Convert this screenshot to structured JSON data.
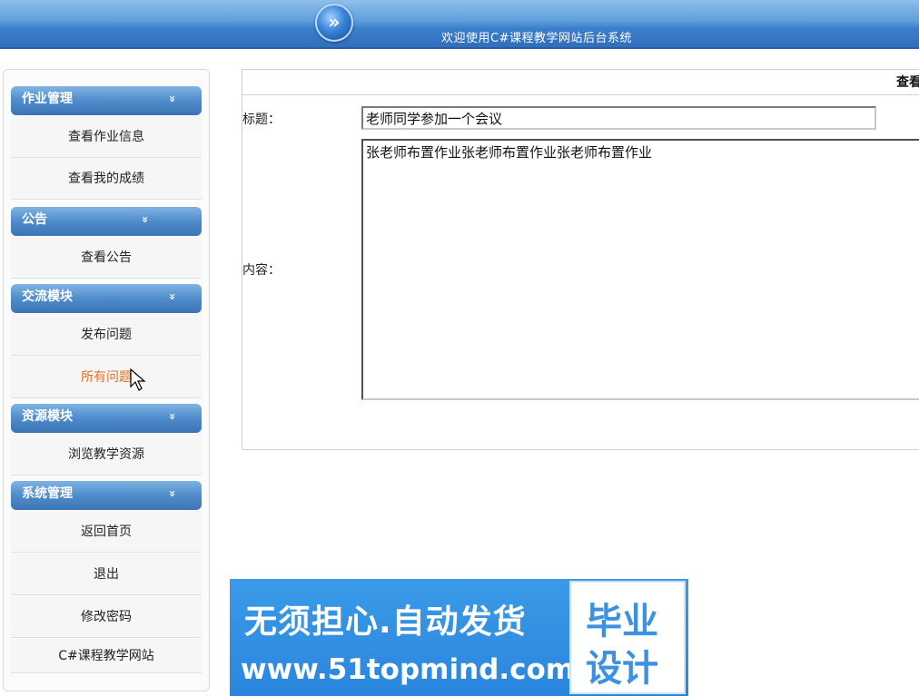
{
  "header": {
    "orb_icon": "double-chevron-right-icon",
    "orb_glyph": "»",
    "title": "欢迎使用C#课程教学网站后台系统"
  },
  "sidebar": {
    "groups": [
      {
        "label": "作业管理",
        "items": [
          "查看作业信息",
          "查看我的成绩"
        ]
      },
      {
        "label": "公告",
        "items": [
          "查看公告"
        ]
      },
      {
        "label": "交流模块",
        "items": [
          "发布问题",
          "所有问题"
        ]
      },
      {
        "label": "资源模块",
        "items": [
          "浏览教学资源"
        ]
      },
      {
        "label": "系统管理",
        "items": [
          "返回首页",
          "退出",
          "修改密码",
          "C#课程教学网站"
        ]
      }
    ],
    "chevron": "»",
    "active_item": "所有问题",
    "active_color": "#e07020"
  },
  "content": {
    "header_text": "查看",
    "title_label": "标题：",
    "title_value": "老师同学参加一个会议",
    "body_label": "内容：",
    "body_value": "张老师布置作业张老师布置作业张老师布置作业"
  },
  "banner": {
    "line1": "无须担心.自动发货",
    "line2": "www.51topmind.com",
    "badge_line1": "毕业",
    "badge_line2": "设计",
    "bg_color": "#2a86dc"
  }
}
